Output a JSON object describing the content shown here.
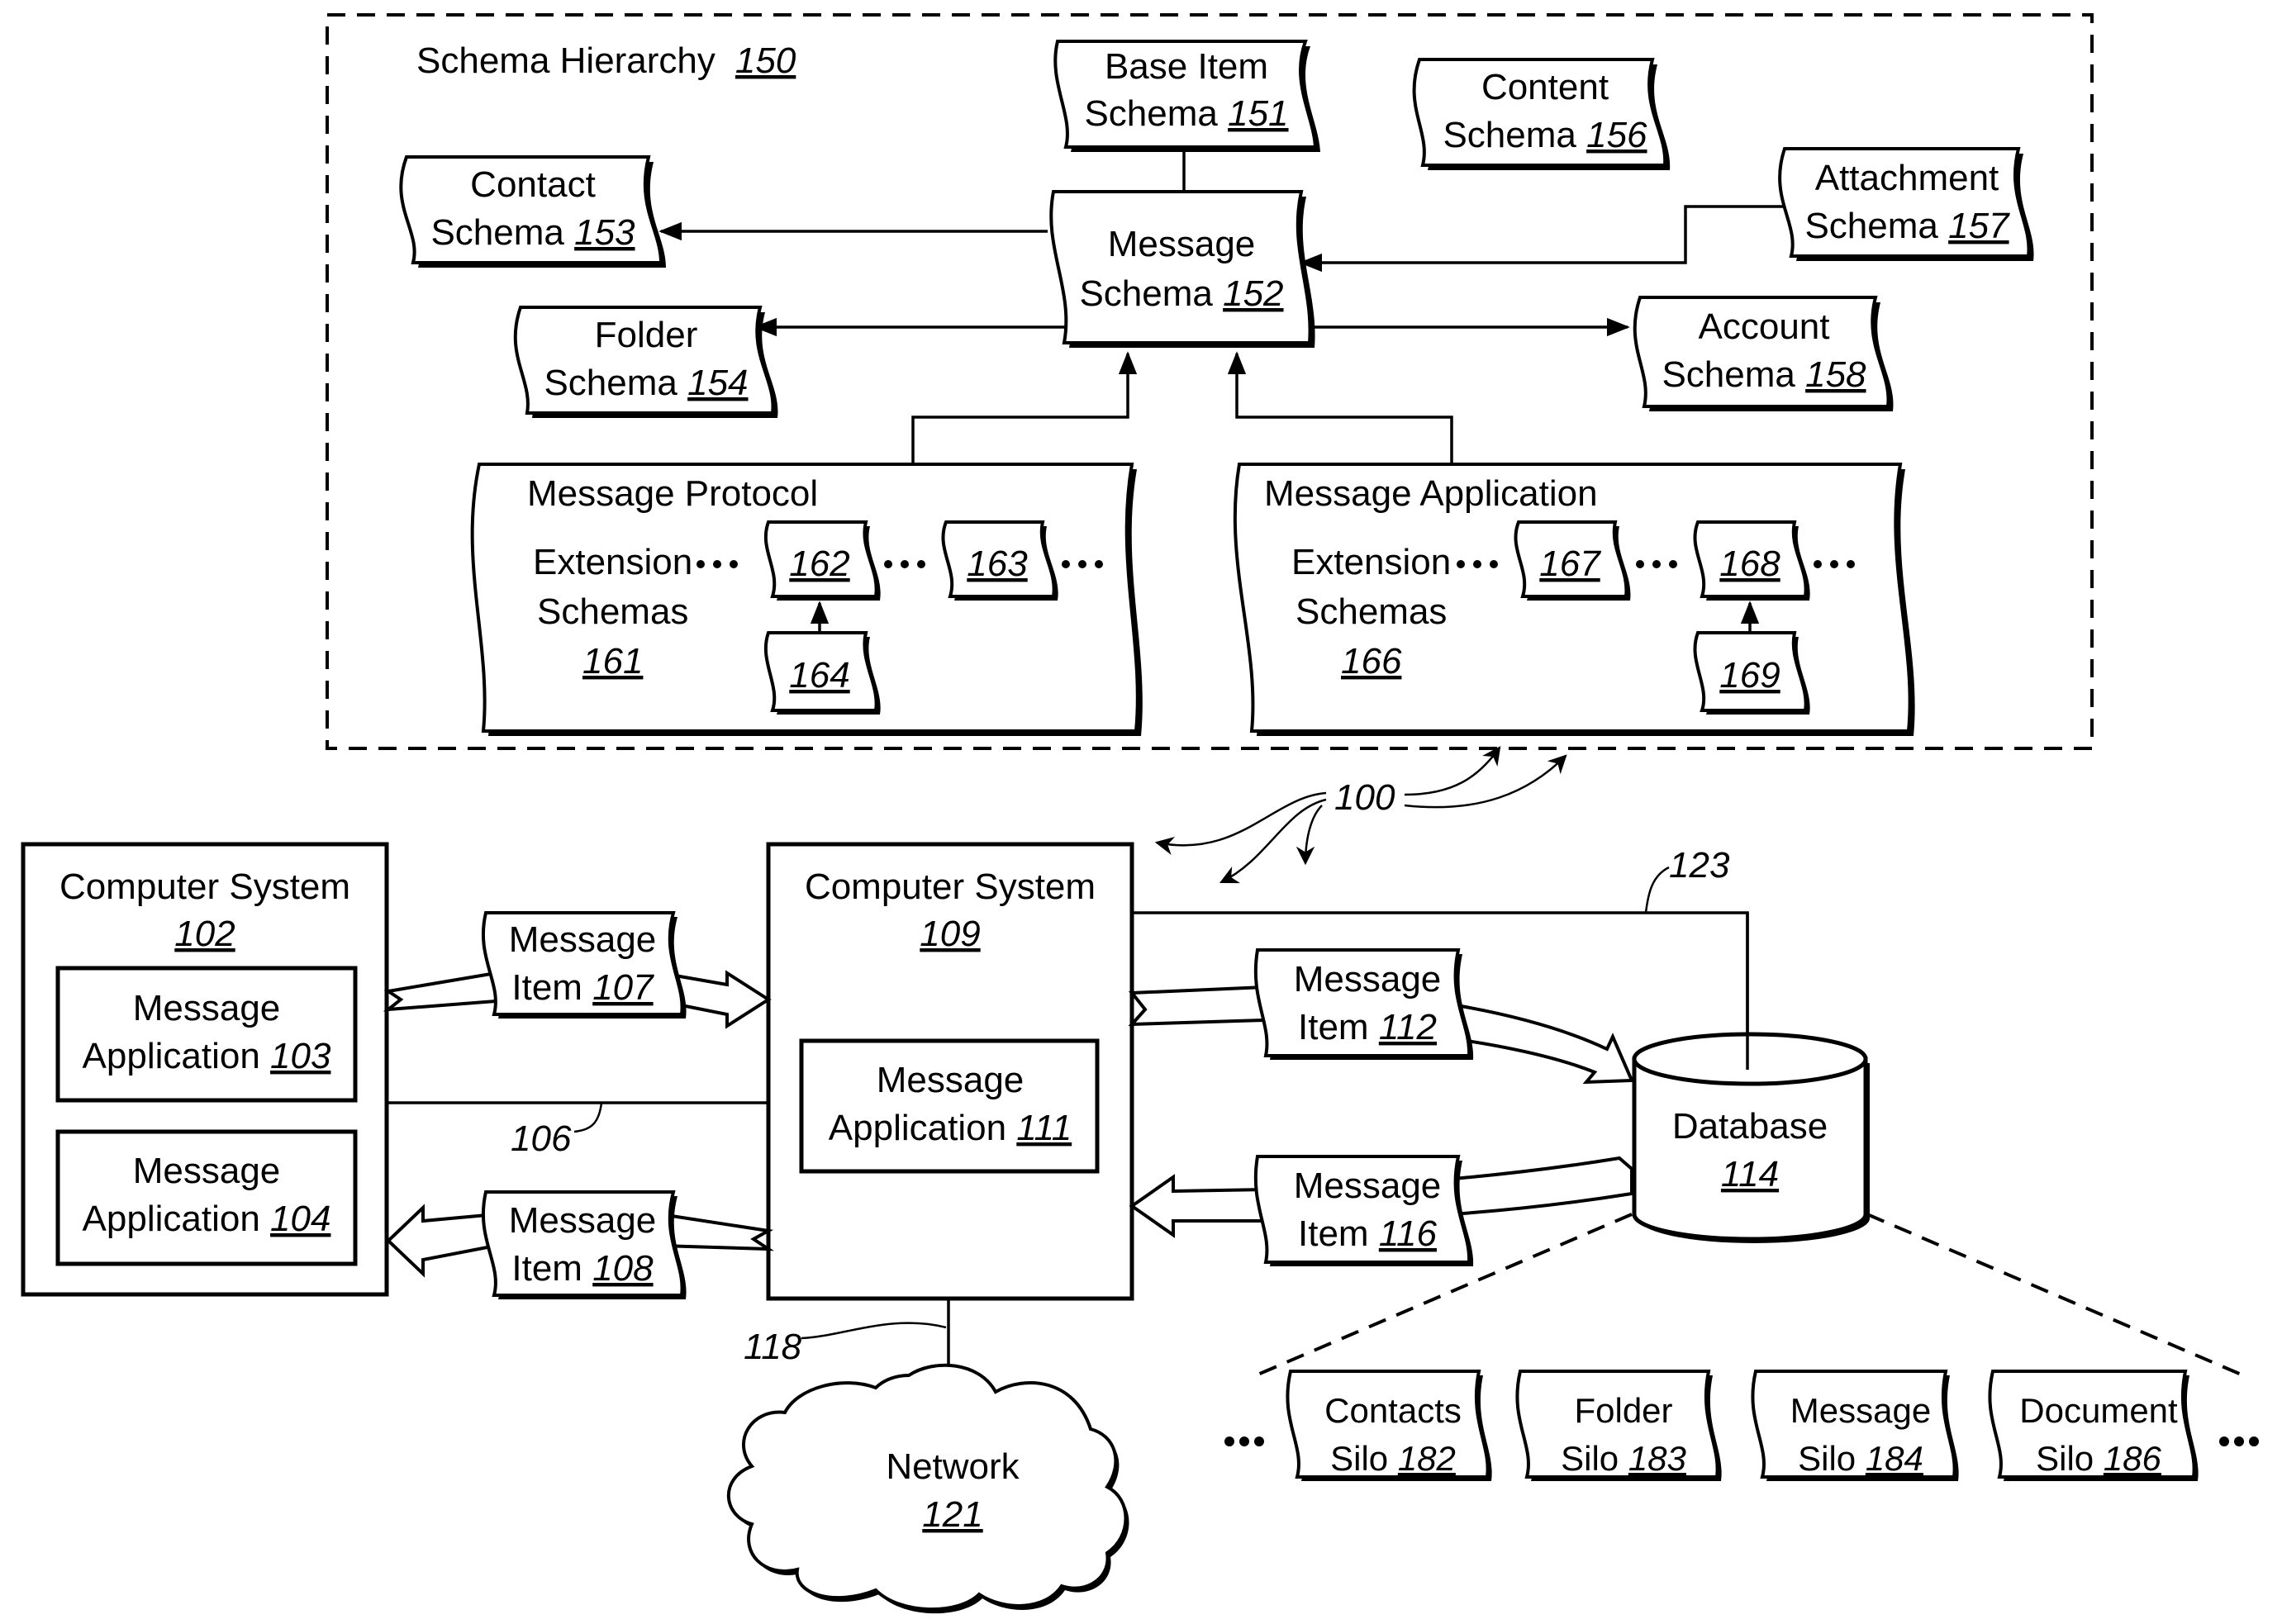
{
  "figure": {
    "reference_numeral": "100",
    "schema_hierarchy": {
      "title": "Schema Hierarchy",
      "ref": "150",
      "base_item_schema": {
        "line1": "Base Item",
        "line2": "Schema",
        "ref": "151"
      },
      "message_schema": {
        "line1": "Message",
        "line2": "Schema",
        "ref": "152"
      },
      "contact_schema": {
        "line1": "Contact",
        "line2": "Schema",
        "ref": "153"
      },
      "folder_schema": {
        "line1": "Folder",
        "line2": "Schema",
        "ref": "154"
      },
      "content_schema": {
        "line1": "Content",
        "line2": "Schema",
        "ref": "156"
      },
      "attachment_schema": {
        "line1": "Attachment",
        "line2": "Schema",
        "ref": "157"
      },
      "account_schema": {
        "line1": "Account",
        "line2": "Schema",
        "ref": "158"
      },
      "protocol_group": {
        "title": "Message Protocol",
        "line1": "Extension",
        "line2": "Schemas",
        "ref": "161",
        "items": [
          "162",
          "163",
          "164"
        ]
      },
      "application_group": {
        "title": "Message Application",
        "line1": "Extension",
        "line2": "Schemas",
        "ref": "166",
        "items": [
          "167",
          "168",
          "169"
        ]
      }
    },
    "computer_system_102": {
      "title": "Computer System",
      "ref": "102",
      "app_103": {
        "line1": "Message",
        "line2": "Application",
        "ref": "103"
      },
      "app_104": {
        "line1": "Message",
        "line2": "Application",
        "ref": "104"
      }
    },
    "computer_system_109": {
      "title": "Computer System",
      "ref": "109",
      "app_111": {
        "line1": "Message",
        "line2": "Application",
        "ref": "111"
      }
    },
    "message_items": {
      "item_107": {
        "line1": "Message",
        "line2": "Item",
        "ref": "107"
      },
      "item_108": {
        "line1": "Message",
        "line2": "Item",
        "ref": "108"
      },
      "item_112": {
        "line1": "Message",
        "line2": "Item",
        "ref": "112"
      },
      "item_116": {
        "line1": "Message",
        "line2": "Item",
        "ref": "116"
      }
    },
    "connections": {
      "link_106": "106",
      "link_118": "118",
      "link_123": "123"
    },
    "database": {
      "title": "Database",
      "ref": "114"
    },
    "network": {
      "title": "Network",
      "ref": "121"
    },
    "silos": [
      {
        "line1": "Contacts",
        "line2": "Silo",
        "ref": "182"
      },
      {
        "line1": "Folder",
        "line2": "Silo",
        "ref": "183"
      },
      {
        "line1": "Message",
        "line2": "Silo",
        "ref": "184"
      },
      {
        "line1": "Document",
        "line2": "Silo",
        "ref": "186"
      }
    ]
  }
}
